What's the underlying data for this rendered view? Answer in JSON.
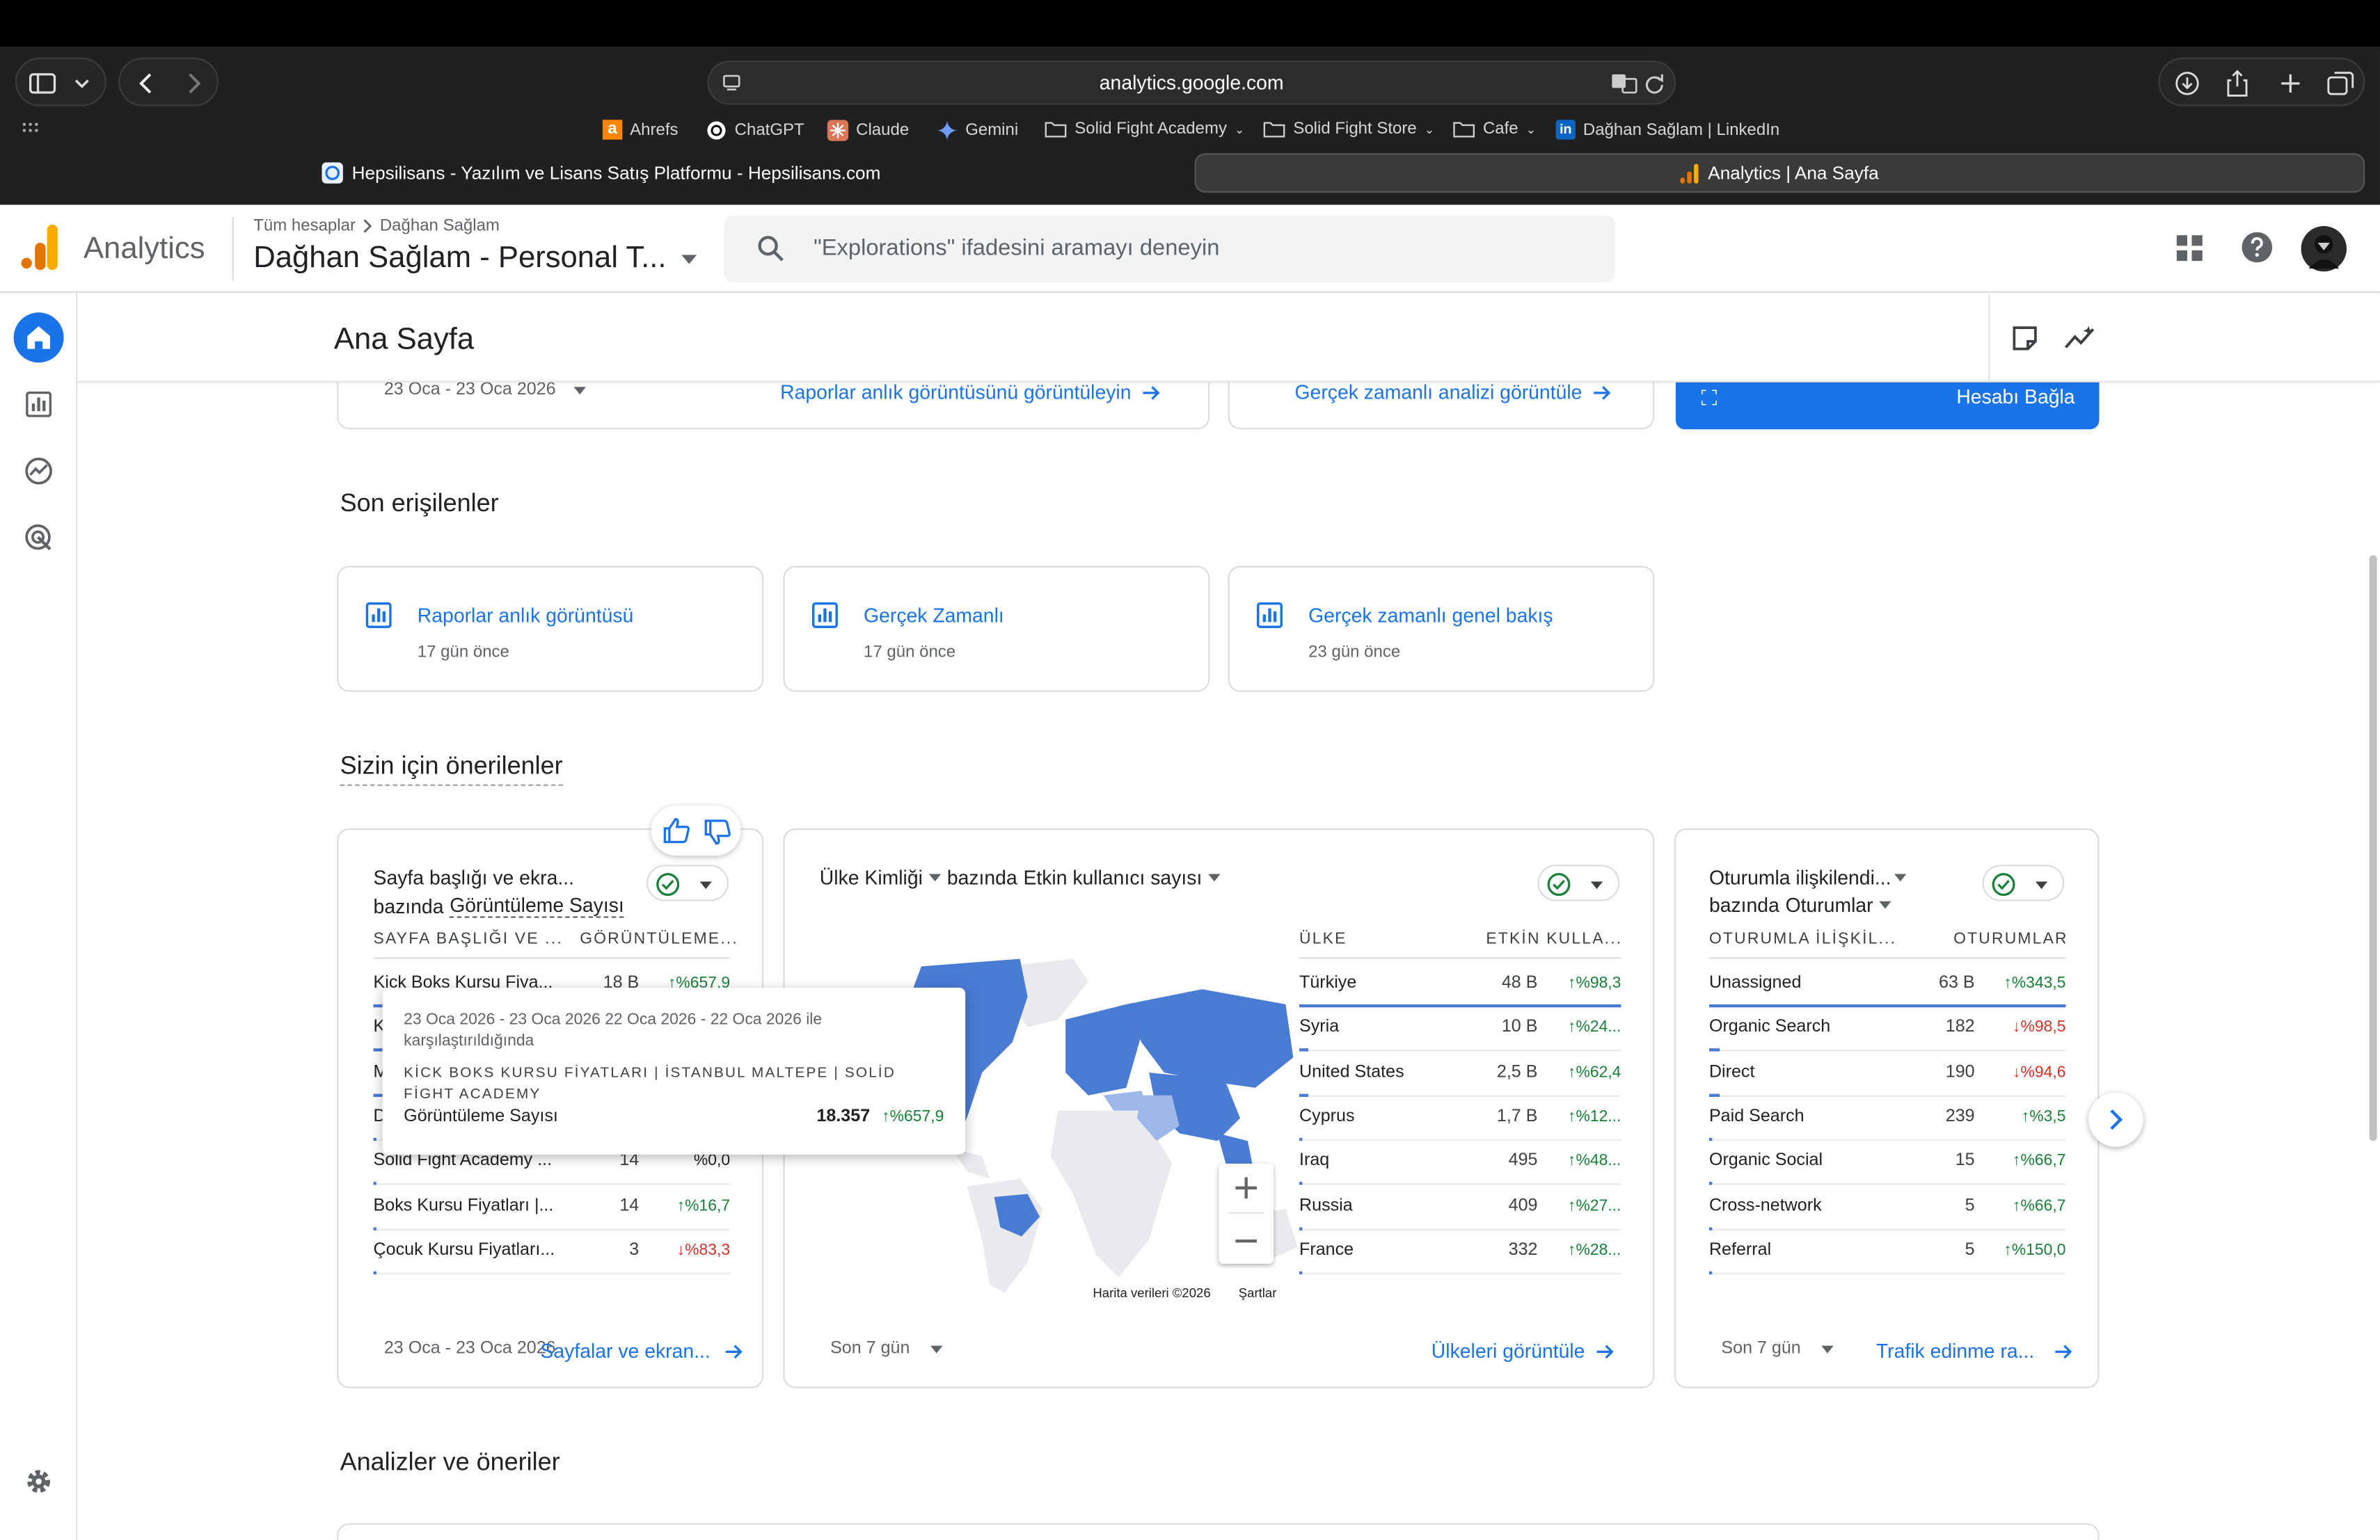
{
  "browser": {
    "url": "analytics.google.com",
    "bookmarks": [
      "Ahrefs",
      "ChatGPT",
      "Claude",
      "Gemini",
      "Solid Fight Academy",
      "Solid Fight Store",
      "Cafe",
      "Dağhan Sağlam | LinkedIn"
    ],
    "tabs": [
      {
        "title": "Hepsilisans - Yazılım ve Lisans Satış Platformu - Hepsilisans.com",
        "active": false
      },
      {
        "title": "Analytics | Ana Sayfa",
        "active": true
      }
    ]
  },
  "header": {
    "product": "Analytics",
    "breadcrumb_root": "Tüm hesaplar",
    "breadcrumb_account": "Dağhan Sağlam",
    "property": "Dağhan Sağlam - Personal T...",
    "search_placeholder": "\"Explorations\" ifadesini aramayı deneyin"
  },
  "page": {
    "title": "Ana Sayfa",
    "top_cards": {
      "date_range": "23 Oca - 23 Oca 2026",
      "snapshot_link": "Raporlar anlık görüntüsünü görüntüleyin",
      "realtime_link": "Gerçek zamanlı analizi görüntüle",
      "connect_button": "Hesabı Bağla"
    },
    "recent": {
      "heading": "Son erişilenler",
      "items": [
        {
          "title": "Raporlar anlık görüntüsü",
          "time": "17 gün önce"
        },
        {
          "title": "Gerçek Zamanlı",
          "time": "17 gün önce"
        },
        {
          "title": "Gerçek zamanlı genel bakış",
          "time": "23 gün önce"
        }
      ]
    },
    "recommended_heading": "Sizin için önerilenler",
    "insights_heading": "Analizler ve öneriler"
  },
  "cards": {
    "pages": {
      "title1": "Sayfa başlığı ve ekra...",
      "title2_prefix": "bazında",
      "title2_metric": "Görüntüleme Sayısı",
      "col1": "SAYFA BAŞLIĞI VE ...",
      "col2": "GÖRÜNTÜLEME...",
      "rows": [
        {
          "name": "Kick Boks Kursu Fiya...",
          "value": "18 B",
          "change": "%657,9",
          "dir": "up"
        },
        {
          "name": "K",
          "value": "",
          "change": "",
          "dir": ""
        },
        {
          "name": "M",
          "value": "",
          "change": "",
          "dir": ""
        },
        {
          "name": "D",
          "value": "",
          "change": "",
          "dir": ""
        },
        {
          "name": "Solid Fight Academy ...",
          "value": "14",
          "change": "%0,0",
          "dir": "flat"
        },
        {
          "name": "Boks Kursu Fiyatları |...",
          "value": "14",
          "change": "%16,7",
          "dir": "up"
        },
        {
          "name": "Çocuk Kursu Fiyatları...",
          "value": "3",
          "change": "%83,3",
          "dir": "dn"
        }
      ],
      "footer_date": "23 Oca - 23 Oca 2026",
      "footer_link": "Sayfalar ve ekran..."
    },
    "tooltip": {
      "compare": "23 Oca 2026 - 23 Oca 2026 22 Oca 2026 - 22 Oca 2026 ile karşılaştırıldığında",
      "page": "KİCK BOKS KURSU FİYATLARI | İSTANBUL MALTEPE | SOLİD FİGHT ACADEMY",
      "metric": "Görüntüleme Sayısı",
      "value": "18.357",
      "change": "%657,9"
    },
    "country": {
      "dim": "Ülke Kimliği",
      "by": "bazında",
      "metric": "Etkin kullanıcı sayısı",
      "col1": "ÜLKE",
      "col2": "ETKİN KULLA...",
      "rows": [
        {
          "name": "Türkiye",
          "value": "48 B",
          "change": "%98,3",
          "dir": "up"
        },
        {
          "name": "Syria",
          "value": "10 B",
          "change": "%24...",
          "dir": "up"
        },
        {
          "name": "United States",
          "value": "2,5 B",
          "change": "%62,4",
          "dir": "up"
        },
        {
          "name": "Cyprus",
          "value": "1,7 B",
          "change": "%12...",
          "dir": "up"
        },
        {
          "name": "Iraq",
          "value": "495",
          "change": "%48...",
          "dir": "up"
        },
        {
          "name": "Russia",
          "value": "409",
          "change": "%27...",
          "dir": "up"
        },
        {
          "name": "France",
          "value": "332",
          "change": "%28...",
          "dir": "up"
        }
      ],
      "map_credit": "Harita verileri ©2026",
      "map_terms": "Şartlar",
      "footer_period": "Son 7 gün",
      "footer_link": "Ülkeleri görüntüle"
    },
    "session": {
      "title1": "Oturumla ilişkilendi...",
      "title2_prefix": "bazında",
      "title2_metric": "Oturumlar",
      "col1": "OTURUMLA İLİŞKİL...",
      "col2": "OTURUMLAR",
      "rows": [
        {
          "name": "Unassigned",
          "value": "63 B",
          "change": "%343,5",
          "dir": "up"
        },
        {
          "name": "Organic Search",
          "value": "182",
          "change": "%98,5",
          "dir": "dn"
        },
        {
          "name": "Direct",
          "value": "190",
          "change": "%94,6",
          "dir": "dn"
        },
        {
          "name": "Paid Search",
          "value": "239",
          "change": "%3,5",
          "dir": "up"
        },
        {
          "name": "Organic Social",
          "value": "15",
          "change": "%66,7",
          "dir": "up"
        },
        {
          "name": "Cross-network",
          "value": "5",
          "change": "%66,7",
          "dir": "up"
        },
        {
          "name": "Referral",
          "value": "5",
          "change": "%150,0",
          "dir": "up"
        }
      ],
      "footer_period": "Son 7 gün",
      "footer_link": "Trafik edinme ra..."
    }
  },
  "colors": {
    "accent": "#1a73e8",
    "ga_orange": "#f9ab00",
    "ga_dark_orange": "#e37400",
    "map_fill": "#4a7bd4"
  }
}
